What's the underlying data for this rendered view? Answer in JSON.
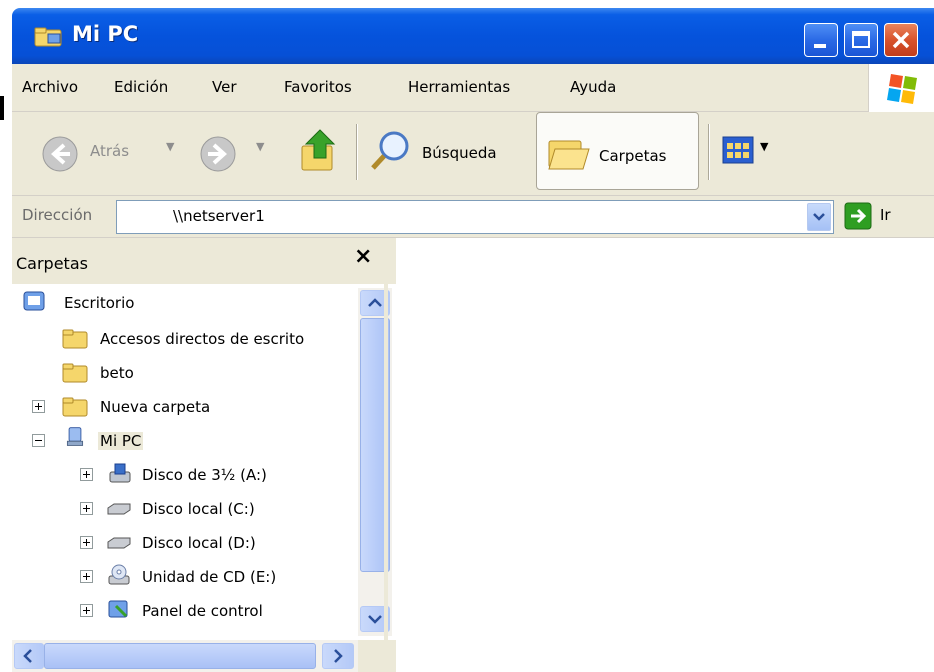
{
  "window": {
    "title": "Mi PC"
  },
  "menu": [
    "Archivo",
    "Edición",
    "Ver",
    "Favoritos",
    "Herramientas",
    "Ayuda"
  ],
  "toolbar": {
    "back_label": "Atrás",
    "search_label": "Búsqueda",
    "folders_label": "Carpetas"
  },
  "address": {
    "label": "Dirección",
    "value": "\\\\netserver1",
    "go_label": "Ir"
  },
  "folder_pane": {
    "title": "Carpetas",
    "close_glyph": "×",
    "items": [
      {
        "label": "Escritorio"
      },
      {
        "label": "Accesos directos de escrito"
      },
      {
        "label": "beto"
      },
      {
        "label": "Nueva carpeta"
      },
      {
        "label": "Mi PC"
      },
      {
        "label": "Disco de 3½ (A:)"
      },
      {
        "label": "Disco local (C:)"
      },
      {
        "label": "Disco local (D:)"
      },
      {
        "label": "Unidad de CD (E:)"
      },
      {
        "label": "Panel de control"
      }
    ]
  },
  "colors": {
    "titlebar": "#0553dc",
    "chrome": "#ece9d8",
    "folder_yellow": "#f5d66b",
    "go_green": "#2f9e22"
  }
}
